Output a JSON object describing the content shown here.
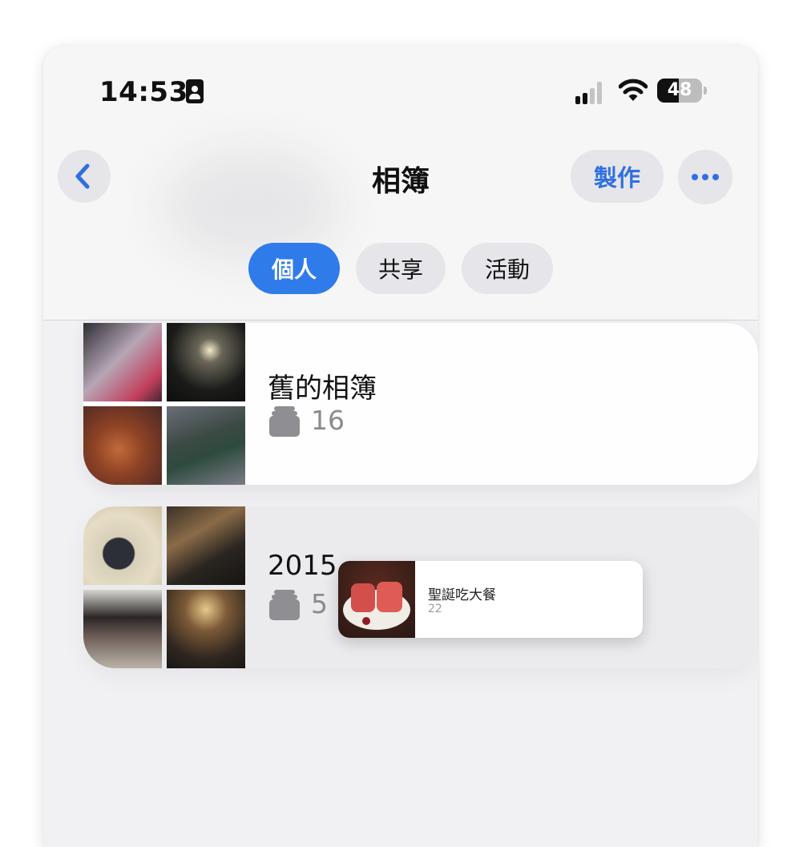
{
  "status_bar": {
    "time": "14:53",
    "battery_level": "48"
  },
  "nav": {
    "title": "相簿",
    "make_label": "製作"
  },
  "segments": [
    {
      "label": "個人",
      "active": true
    },
    {
      "label": "共享",
      "active": false
    },
    {
      "label": "活動",
      "active": false
    }
  ],
  "albums": [
    {
      "name": "舊的相簿",
      "count": "16"
    },
    {
      "name": "2015",
      "count": "5"
    }
  ],
  "drag_preview": {
    "title": "聖誕吃大餐",
    "count": "22"
  },
  "colors": {
    "accent": "#2f7bea",
    "button_bg": "#e5e5ea",
    "count_gray": "#8b8b8f"
  },
  "icons": [
    "id-card-icon",
    "cellular-signal-icon",
    "wifi-icon",
    "battery-icon",
    "chevron-left-icon",
    "ellipsis-icon",
    "photo-stack-icon"
  ]
}
